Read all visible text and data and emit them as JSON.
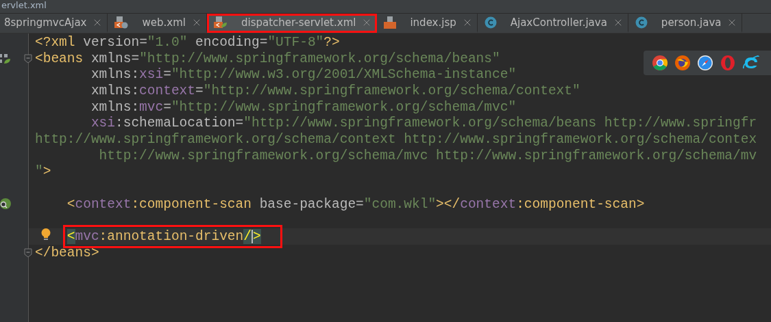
{
  "window": {
    "title": "ervlet.xml"
  },
  "tabs": [
    {
      "label": "8springmvcAjax",
      "kind": "none",
      "selected": false
    },
    {
      "label": "web.xml",
      "kind": "web-xml",
      "selected": false
    },
    {
      "label": "dispatcher-servlet.xml",
      "kind": "spring-xml",
      "selected": true,
      "annotated": true
    },
    {
      "label": "index.jsp",
      "kind": "jsp",
      "selected": false
    },
    {
      "label": "AjaxController.java",
      "kind": "class",
      "selected": false
    },
    {
      "label": "person.java",
      "kind": "class",
      "selected": false
    }
  ],
  "browser_bar": {
    "browsers": [
      {
        "kind": "chrome"
      },
      {
        "kind": "firefox"
      },
      {
        "kind": "safari"
      },
      {
        "kind": "opera"
      },
      {
        "kind": "ie"
      }
    ]
  },
  "editor": {
    "lines": [
      {
        "kind": "plain",
        "tokens": [
          {
            "kind": "tag",
            "text": "<?xml"
          },
          {
            "kind": "attr",
            "text": " version="
          },
          {
            "kind": "value",
            "text": "\"1.0\""
          },
          {
            "kind": "attr",
            "text": " encoding="
          },
          {
            "kind": "value",
            "text": "\"UTF-8\""
          },
          {
            "kind": "tag",
            "text": "?>"
          }
        ]
      },
      {
        "kind": "bean",
        "fold": true,
        "tokens": [
          {
            "kind": "tag",
            "text": "<beans"
          },
          {
            "kind": "attr",
            "text": " xmlns="
          },
          {
            "kind": "value",
            "text": "\"http://www.springframework.org/schema/beans\""
          }
        ]
      },
      {
        "kind": "attribute",
        "tokens": [
          {
            "kind": "attr",
            "text": "xmlns:"
          },
          {
            "kind": "ns",
            "text": "xsi"
          },
          {
            "kind": "attr",
            "text": "="
          },
          {
            "kind": "value",
            "text": "\"http://www.w3.org/2001/XMLSchema-instance\""
          }
        ]
      },
      {
        "kind": "attribute",
        "tokens": [
          {
            "kind": "attr",
            "text": "xmlns:"
          },
          {
            "kind": "ns",
            "text": "context"
          },
          {
            "kind": "attr",
            "text": "="
          },
          {
            "kind": "value",
            "text": "\"http://www.springframework.org/schema/context\""
          }
        ]
      },
      {
        "kind": "attribute",
        "tokens": [
          {
            "kind": "attr",
            "text": "xmlns:"
          },
          {
            "kind": "ns",
            "text": "mvc"
          },
          {
            "kind": "attr",
            "text": "="
          },
          {
            "kind": "value",
            "text": "\"http://www.springframework.org/schema/mvc\""
          }
        ]
      },
      {
        "kind": "attribute",
        "tokens": [
          {
            "kind": "ns",
            "text": "xsi"
          },
          {
            "kind": "attr",
            "text": ":schemaLocation="
          },
          {
            "kind": "value",
            "text": "\"http://www.springframework.org/schema/beans http://www.springfr"
          }
        ]
      },
      {
        "kind": "plain",
        "tokens": [
          {
            "kind": "value",
            "text": "http://www.springframework.org/schema/context http://www.springframework.org/schema/contex"
          }
        ]
      },
      {
        "kind": "continuation",
        "tokens": [
          {
            "kind": "value",
            "text": "http://www.springframework.org/schema/mvc http://www.springframework.org/schema/mv"
          }
        ]
      },
      {
        "kind": "plain",
        "tokens": [
          {
            "kind": "value",
            "text": "\""
          },
          {
            "kind": "tag",
            "text": ">"
          }
        ]
      },
      {
        "kind": "plain"
      },
      {
        "kind": "bean-search",
        "tokens": [
          {
            "kind": "tag",
            "text": "<"
          },
          {
            "kind": "ns",
            "text": "context"
          },
          {
            "kind": "tag",
            "text": ":component-scan"
          },
          {
            "kind": "attr",
            "text": " base-package="
          },
          {
            "kind": "value",
            "text": "\"com.wkl\""
          },
          {
            "kind": "tag",
            "text": "></"
          },
          {
            "kind": "ns",
            "text": "context"
          },
          {
            "kind": "tag",
            "text": ":component-scan>"
          }
        ]
      },
      {
        "kind": "plain"
      },
      {
        "kind": "bulb",
        "current": true,
        "annotated": true,
        "tokens": [
          {
            "kind": "match",
            "text": "<"
          },
          {
            "kind": "ns",
            "text": "mvc"
          },
          {
            "kind": "tag",
            "text": ":annotation-driven"
          },
          {
            "kind": "match",
            "text": "/",
            "caret": true
          },
          {
            "kind": "match",
            "text": ">"
          }
        ]
      },
      {
        "kind": "plain",
        "fold": true,
        "tokens": [
          {
            "kind": "tag",
            "text": "</beans>"
          }
        ]
      }
    ]
  }
}
